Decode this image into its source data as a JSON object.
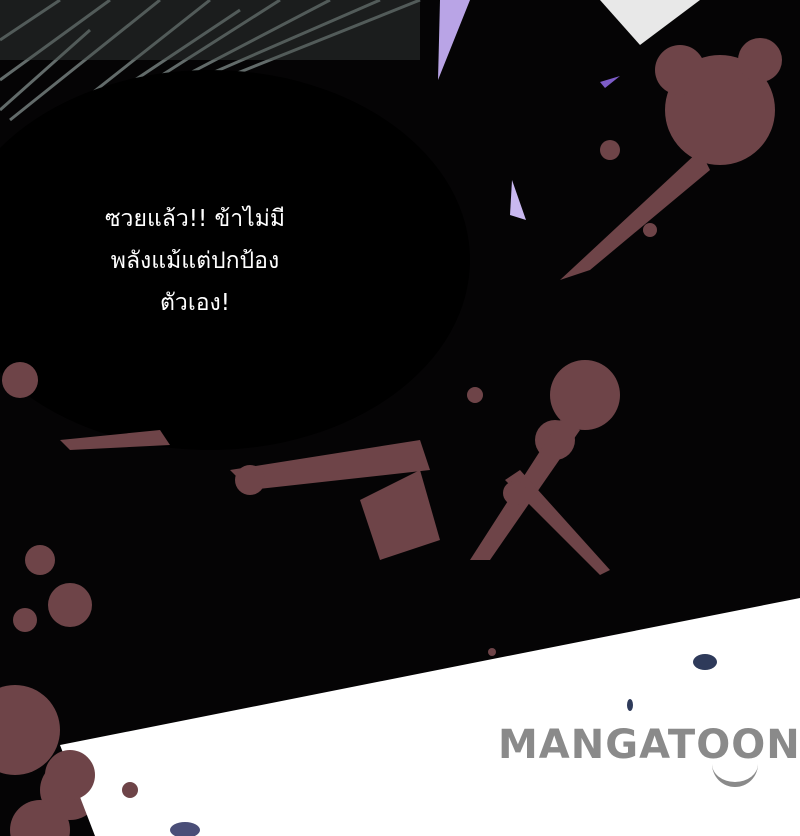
{
  "speech_bubble": {
    "lines": [
      "ซวยแล้ว!! ข้าไม่มี",
      "พลังแม้แต่ปกป้อง",
      "ตัวเอง!"
    ]
  },
  "watermark": {
    "text": "MANGATOON"
  },
  "colors": {
    "background": "#050405",
    "blood": "#6e4448",
    "panel_white": "#ffffff",
    "shard_purple": "#b9a4e6",
    "streak_gray": "#7a8584",
    "text": "#ffffff",
    "logo_gray": "#8a8a8a"
  }
}
